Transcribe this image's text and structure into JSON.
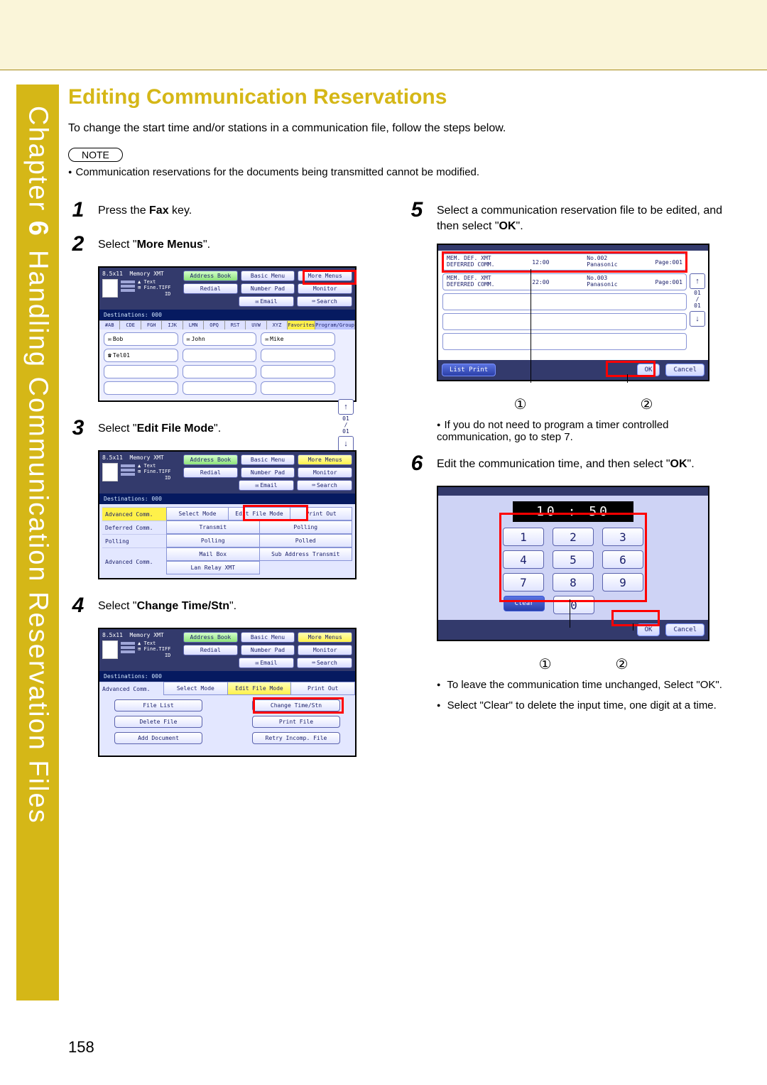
{
  "chapter": {
    "label": "Chapter",
    "num": "6",
    "title": "Handling Communication Reservation Files"
  },
  "heading": "Editing Communication Reservations",
  "intro": "To change the start time and/or stations in a communication file, follow the steps below.",
  "note_label": "NOTE",
  "note_text": "Communication reservations for the documents being transmitted cannot be modified.",
  "page_num": "158",
  "steps": {
    "s1": {
      "n": "1",
      "pre": "Press the ",
      "b": "Fax",
      "post": " key."
    },
    "s2": {
      "n": "2",
      "pre": "Select \"",
      "b": "More Menus",
      "post": "\"."
    },
    "s3": {
      "n": "3",
      "pre": "Select \"",
      "b": "Edit File Mode",
      "post": "\"."
    },
    "s4": {
      "n": "4",
      "pre": "Select \"",
      "b": "Change Time/Stn",
      "post": "\"."
    },
    "s5": {
      "n": "5",
      "line1": "Select a communication reservation file to be edited, and then select \"",
      "b": "OK",
      "post": "\"."
    },
    "s5b": "If you do not need to program a timer controlled communication, go to step 7.",
    "s6": {
      "n": "6",
      "line1": "Edit the communication time, and then select \"",
      "b": "OK",
      "post": "\"."
    },
    "s6b1_pre": "To leave the communication time unchanged, Select \"",
    "s6b1_b": "OK",
    "s6b1_post": "\".",
    "s6b2_pre": "Select \"",
    "s6b2_b": "Clear",
    "s6b2_post": "\" to delete the input time, one digit at a time."
  },
  "callouts": {
    "c1": "①",
    "c2": "②"
  },
  "ui": {
    "top": {
      "size": "8.5x11",
      "mode": "Memory XMT",
      "text": "Text",
      "fine": "Fine.TIFF",
      "id": "ID",
      "addr_book": "Address Book",
      "basic": "Basic Menu",
      "more": "More Menus",
      "redial": "Redial",
      "numpad": "Number Pad",
      "monitor": "Monitor",
      "email": "Email",
      "search": "Search",
      "dest": "Destinations: 000"
    },
    "tabs": [
      "#AB",
      "CDE",
      "FGH",
      "IJK",
      "LMN",
      "OPQ",
      "RST",
      "UVW",
      "XYZ",
      "Favorites",
      "Program/Group"
    ],
    "contacts": {
      "bob": "Bob",
      "john": "John",
      "mike": "Mike",
      "tel": "Tel01"
    },
    "scroll": "01\n/\n01",
    "modeB": {
      "advanced": "Advanced Comm.",
      "select_mode": "Select Mode",
      "edit_file": "Edit File Mode",
      "print_out": "Print Out",
      "deferred": "Deferred Comm.",
      "transmit": "Transmit",
      "polling": "Polling",
      "polled": "Polled",
      "poll_row": "Polling",
      "mailbox": "Mail Box",
      "sub_addr": "Sub Address Transmit",
      "lan_relay": "Lan Relay XMT",
      "adv_row": "Advanced Comm."
    },
    "modeC": {
      "file_list": "File List",
      "change": "Change Time/Stn",
      "delete": "Delete File",
      "print_file": "Print File",
      "add_doc": "Add Document",
      "retry": "Retry Incomp. File"
    },
    "listD": {
      "r1": {
        "a": "MEM. DEF. XMT",
        "b": "DEFERRED COMM.",
        "t": "12:00",
        "n": "No.002",
        "p": "Page:001",
        "s": "Panasonic"
      },
      "r2": {
        "a": "MEM. DEF. XMT",
        "b": "DEFERRED COMM.",
        "t": "22:00",
        "n": "No.003",
        "p": "Page:001",
        "s": "Panasonic"
      },
      "list_print": "List Print",
      "ok": "OK",
      "cancel": "Cancel"
    },
    "keypad": {
      "display": "10 : 50",
      "keys": [
        "1",
        "2",
        "3",
        "4",
        "5",
        "6",
        "7",
        "8",
        "9",
        "0"
      ],
      "clear": "Clear",
      "ok": "OK",
      "cancel": "Cancel"
    }
  }
}
